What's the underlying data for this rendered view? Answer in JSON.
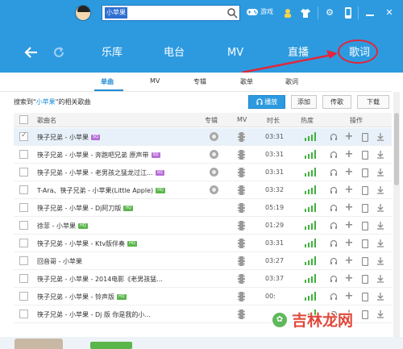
{
  "colors": {
    "accent": "#2d9ae0",
    "highlight": "#e8f1fa",
    "annotation": "#e0283a",
    "heat": "#3fb23d"
  },
  "titlebar": {
    "search_value": "小苹果",
    "game_label": "游戏",
    "icons": [
      "controller-icon",
      "user-plus-icon",
      "shirt-icon",
      "gear-icon",
      "phone-icon",
      "minimize-icon",
      "close-icon"
    ]
  },
  "navbar": {
    "items": [
      "乐库",
      "电台",
      "MV",
      "直播",
      "歌词"
    ]
  },
  "subtabs": [
    "单曲",
    "MV",
    "专辑",
    "歌单",
    "歌词"
  ],
  "results": {
    "prefix": "搜索到\"",
    "query": "小苹果",
    "suffix": "\"的相关歌曲",
    "buttons": {
      "play": "播放",
      "add": "添加",
      "send": "传歌",
      "download": "下载"
    }
  },
  "table": {
    "headers": {
      "name": "歌曲名",
      "album": "专辑",
      "mv": "MV",
      "duration": "时长",
      "heat": "热度",
      "ops": "操作"
    },
    "rows": [
      {
        "name": "筷子兄弟 - 小苹果",
        "badge": "SQ",
        "album": true,
        "duration": "03:31",
        "checked": true,
        "hl": true
      },
      {
        "name": "筷子兄弟 - 小苹果 - 奔跑吧兄弟 原声带",
        "badge": "SQ",
        "album": true,
        "duration": "03:31",
        "checked": false
      },
      {
        "name": "筷子兄弟 - 小苹果 - 老男孩之猛龙过江...",
        "badge": "SQ",
        "album": true,
        "duration": "03:31",
        "checked": false
      },
      {
        "name": "T-Ara、筷子兄弟 - 小苹果(Little Apple)",
        "badge": "HQ",
        "album": true,
        "duration": "03:32",
        "checked": false
      },
      {
        "name": "筷子兄弟 - 小苹果 - Dj阿刀版",
        "badge": "HQ",
        "album": false,
        "duration": "05:19",
        "checked": false
      },
      {
        "name": "徐菲 - 小苹果",
        "badge": "HQ",
        "album": false,
        "duration": "01:29",
        "checked": false
      },
      {
        "name": "筷子兄弟 - 小苹果 - Ktv版伴奏",
        "badge": "HQ",
        "album": false,
        "duration": "03:31",
        "checked": false
      },
      {
        "name": "回音哥 - 小苹果",
        "badge": "",
        "album": false,
        "duration": "03:27",
        "checked": false
      },
      {
        "name": "筷子兄弟 - 小苹果 - 2014电影《老男孩猛...",
        "badge": "",
        "album": false,
        "duration": "03:37",
        "checked": false
      },
      {
        "name": "筷子兄弟 - 小苹果 - 铃声版",
        "badge": "HQ",
        "album": false,
        "duration": "00:",
        "checked": false
      },
      {
        "name": "筷子兄弟 - 小苹果 - Dj 版 你是我的小...",
        "badge": "",
        "album": false,
        "duration": "",
        "checked": false
      }
    ]
  },
  "watermark": {
    "text": "吉林龙网"
  }
}
